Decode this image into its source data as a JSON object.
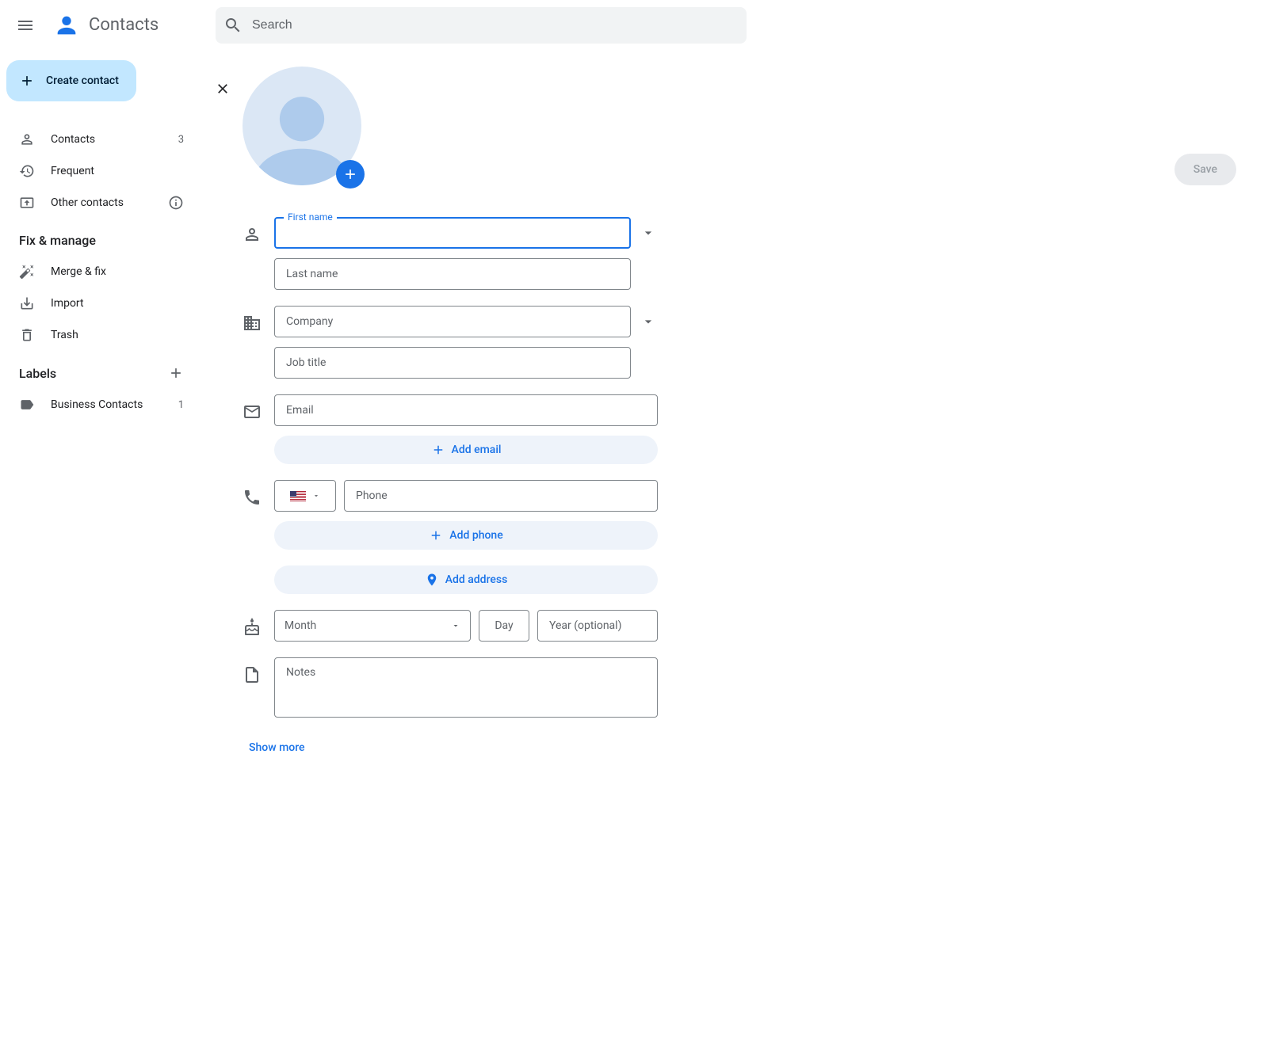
{
  "header": {
    "app_title": "Contacts",
    "search_placeholder": "Search"
  },
  "sidebar": {
    "create_label": "Create contact",
    "nav1": [
      {
        "label": "Contacts",
        "count": "3"
      },
      {
        "label": "Frequent",
        "count": ""
      },
      {
        "label": "Other contacts",
        "count": ""
      }
    ],
    "fix_heading": "Fix & manage",
    "nav2": [
      {
        "label": "Merge & fix"
      },
      {
        "label": "Import"
      },
      {
        "label": "Trash"
      }
    ],
    "labels_heading": "Labels",
    "labels": [
      {
        "label": "Business Contacts",
        "count": "1"
      }
    ]
  },
  "form": {
    "save_label": "Save",
    "first_name_label": "First name",
    "last_name_placeholder": "Last name",
    "company_placeholder": "Company",
    "jobtitle_placeholder": "Job title",
    "email_placeholder": "Email",
    "add_email_label": "Add email",
    "phone_placeholder": "Phone",
    "add_phone_label": "Add phone",
    "add_address_label": "Add address",
    "month_placeholder": "Month",
    "day_placeholder": "Day",
    "year_placeholder": "Year (optional)",
    "notes_placeholder": "Notes",
    "show_more_label": "Show more"
  }
}
